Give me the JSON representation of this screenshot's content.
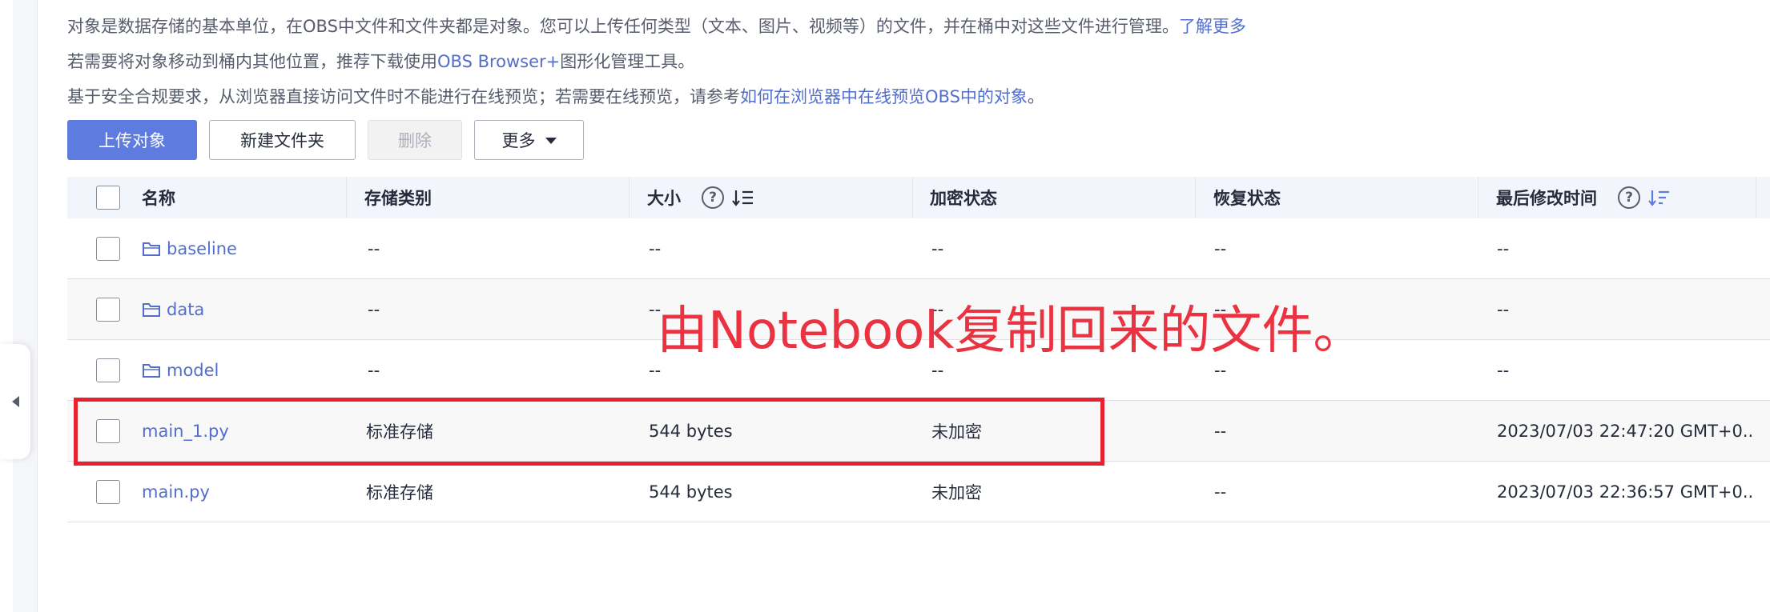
{
  "notices": {
    "line1_text": "对象是数据存储的基本单位，在OBS中文件和文件夹都是对象。您可以上传任何类型（文本、图片、视频等）的文件，并在桶中对这些文件进行管理。",
    "line1_link": "了解更多",
    "line2_pre": "若需要将对象移动到桶内其他位置，推荐下载使用",
    "line2_link": "OBS Browser+",
    "line2_post": "图形化管理工具。",
    "line3_text": "基于安全合规要求，从浏览器直接访问文件时不能进行在线预览；若需要在线预览，请参考",
    "line3_link": "如何在浏览器中在线预览OBS中的对象",
    "line3_post": "。"
  },
  "toolbar": {
    "upload_label": "上传对象",
    "new_folder_label": "新建文件夹",
    "delete_label": "删除",
    "more_label": "更多"
  },
  "table": {
    "columns": {
      "name": "名称",
      "storage_class": "存储类别",
      "size": "大小",
      "encryption": "加密状态",
      "restore": "恢复状态",
      "last_modified": "最后修改时间"
    },
    "rows": [
      {
        "name": "baseline",
        "type": "folder",
        "storage_class": "--",
        "size": "--",
        "encryption": "--",
        "restore": "--",
        "last_modified": "--"
      },
      {
        "name": "data",
        "type": "folder",
        "storage_class": "--",
        "size": "--",
        "encryption": "--",
        "restore": "--",
        "last_modified": "--"
      },
      {
        "name": "model",
        "type": "folder",
        "storage_class": "--",
        "size": "--",
        "encryption": "--",
        "restore": "--",
        "last_modified": "--"
      },
      {
        "name": "main_1.py",
        "type": "file",
        "storage_class": "标准存储",
        "size": "544 bytes",
        "encryption": "未加密",
        "restore": "--",
        "last_modified": "2023/07/03 22:47:20 GMT+0..."
      },
      {
        "name": "main.py",
        "type": "file",
        "storage_class": "标准存储",
        "size": "544 bytes",
        "encryption": "未加密",
        "restore": "--",
        "last_modified": "2023/07/03 22:36:57 GMT+0..."
      }
    ]
  },
  "annotation": {
    "text": "由Notebook复制回来的文件。",
    "color": "#ea3241"
  },
  "colors": {
    "primary": "#5e7ce0",
    "link": "#526ecc",
    "highlight": "#e8212f"
  },
  "icons": {
    "folder": "folder-icon",
    "help": "help-icon",
    "sort": "sort-icon",
    "collapse": "collapse-left-icon"
  }
}
